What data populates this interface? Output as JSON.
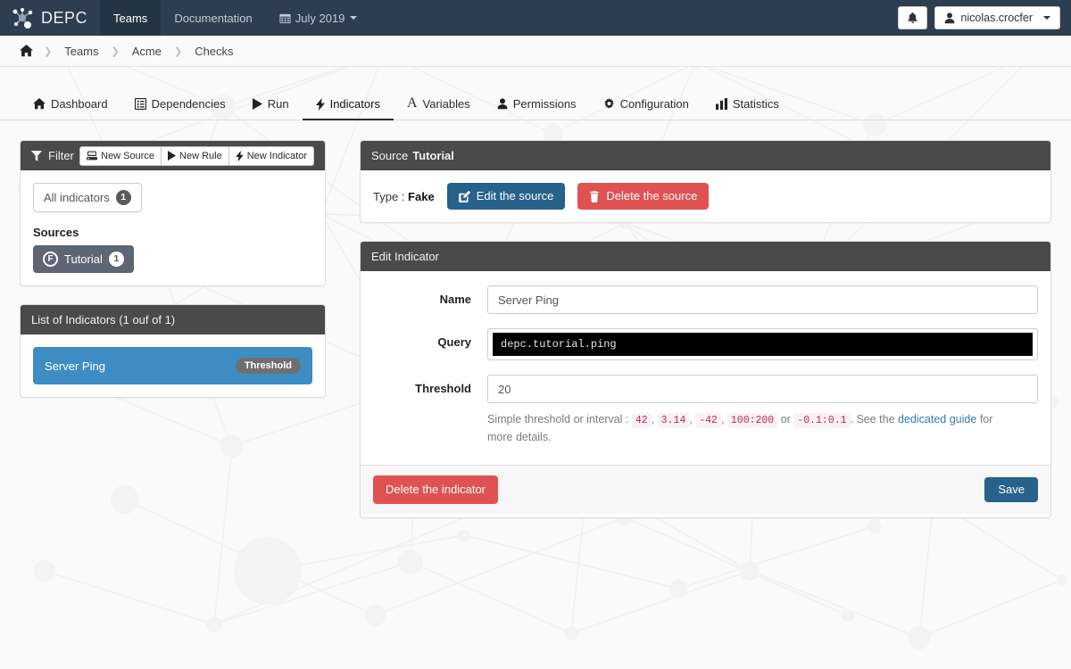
{
  "navbar": {
    "brand": "DEPC",
    "brand_icon": "network-nodes-icon",
    "links": [
      {
        "label": "Teams",
        "active": true
      },
      {
        "label": "Documentation",
        "active": false
      }
    ],
    "period": {
      "label": "July 2019",
      "icon": "calendar-icon"
    },
    "notifications_icon": "bell-icon",
    "user": {
      "label": "nicolas.crocfer",
      "icon": "user-icon"
    },
    "bg_color": "#2c3e50"
  },
  "breadcrumb": {
    "home_icon": "home-icon",
    "items": [
      "Teams",
      "Acme",
      "Checks"
    ],
    "separator": "›"
  },
  "tabs": [
    {
      "label": "Dashboard",
      "icon": "home-icon",
      "active": false
    },
    {
      "label": "Dependencies",
      "icon": "list-icon",
      "active": false
    },
    {
      "label": "Run",
      "icon": "play-icon",
      "active": false
    },
    {
      "label": "Indicators",
      "icon": "bolt-icon",
      "active": true
    },
    {
      "label": "Variables",
      "icon": "font-a-icon",
      "active": false
    },
    {
      "label": "Permissions",
      "icon": "user-icon",
      "active": false
    },
    {
      "label": "Configuration",
      "icon": "gear-icon",
      "active": false
    },
    {
      "label": "Statistics",
      "icon": "bar-chart-icon",
      "active": false
    }
  ],
  "filter_panel": {
    "title": "Filter",
    "title_icon": "filter-icon",
    "buttons": [
      {
        "label": "New Source",
        "icon": "server-icon"
      },
      {
        "label": "New Rule",
        "icon": "play-icon"
      },
      {
        "label": "New Indicator",
        "icon": "bolt-icon"
      }
    ],
    "all_indicators": {
      "label": "All indicators",
      "count": "1"
    },
    "sources_label": "Sources",
    "sources": [
      {
        "letter": "F",
        "label": "Tutorial",
        "count": "1",
        "selected": true
      }
    ]
  },
  "indicator_list_panel": {
    "title": "List of Indicators (1 ouf of 1)",
    "items": [
      {
        "label": "Server Ping",
        "tag": "Threshold",
        "selected": true
      }
    ]
  },
  "source_panel": {
    "title_prefix": "Source",
    "title_name": "Tutorial",
    "type_label": "Type :",
    "type_value": "Fake",
    "edit_button": {
      "label": "Edit the source",
      "icon": "pencil-square-icon"
    },
    "delete_button": {
      "label": "Delete the source",
      "icon": "trash-icon"
    }
  },
  "edit_indicator_panel": {
    "title": "Edit Indicator",
    "fields": {
      "name": {
        "label": "Name",
        "value": "Server Ping",
        "placeholder": "Name"
      },
      "query": {
        "label": "Query",
        "value": "depc.tutorial.ping"
      },
      "threshold": {
        "label": "Threshold",
        "value": "20",
        "placeholder": "Threshold"
      }
    },
    "help": {
      "intro": "Simple threshold or interval :",
      "examples": [
        "42",
        "3.14",
        "-42",
        "100:200"
      ],
      "or": "or",
      "last_example": "-0.1:0.1",
      "see_the": ". See the",
      "link": "dedicated guide",
      "tail": "for more details."
    },
    "delete_button": "Delete the indicator",
    "save_button": "Save"
  },
  "colors": {
    "navbar": "#2c3e50",
    "panel_head": "#4a4a4a",
    "primary": "#26628a",
    "danger": "#e05252",
    "selected_item": "#3d8dc4",
    "source_chip": "#5d6673",
    "link": "#337ab7",
    "code_literal": "#c7254e"
  }
}
